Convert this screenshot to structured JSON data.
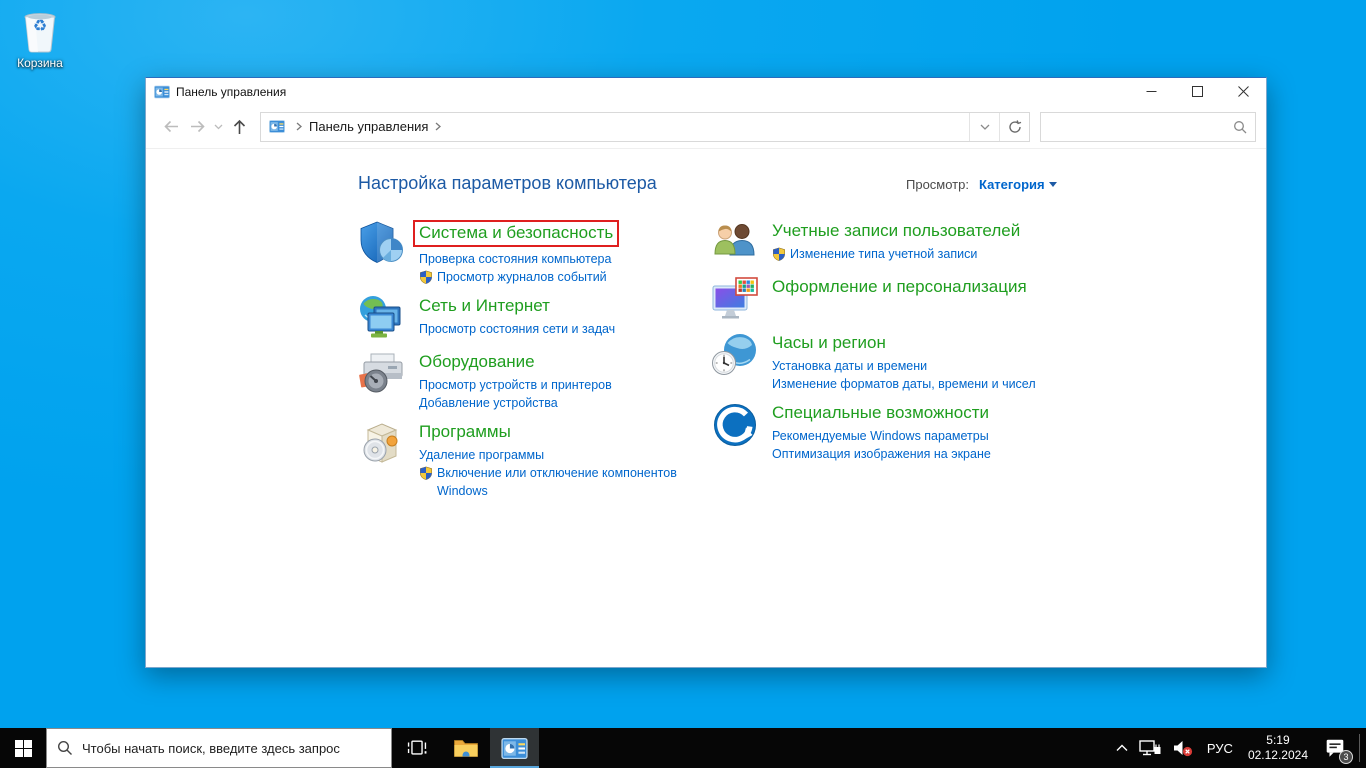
{
  "desktop": {
    "recycle_bin_label": "Корзина"
  },
  "window": {
    "title": "Панель управления",
    "breadcrumb_root": "Панель управления",
    "search_value": ""
  },
  "content": {
    "heading": "Настройка параметров компьютера",
    "view_by_label": "Просмотр:",
    "view_by_value": "Категория",
    "left": [
      {
        "title": "Система и безопасность",
        "highlighted": true,
        "links": [
          {
            "text": "Проверка состояния компьютера",
            "uac": false
          },
          {
            "text": "Просмотр журналов событий",
            "uac": true
          }
        ]
      },
      {
        "title": "Сеть и Интернет",
        "links": [
          {
            "text": "Просмотр состояния сети и задач",
            "uac": false
          }
        ]
      },
      {
        "title": "Оборудование",
        "links": [
          {
            "text": "Просмотр устройств и принтеров",
            "uac": false
          },
          {
            "text": "Добавление устройства",
            "uac": false
          }
        ]
      },
      {
        "title": "Программы",
        "links": [
          {
            "text": "Удаление программы",
            "uac": false
          },
          {
            "text": "Включение или отключение компонентов Windows",
            "uac": true
          }
        ]
      }
    ],
    "right": [
      {
        "title": "Учетные записи пользователей",
        "links": [
          {
            "text": "Изменение типа учетной записи",
            "uac": true
          }
        ]
      },
      {
        "title": "Оформление и персонализация",
        "links": []
      },
      {
        "title": "Часы и регион",
        "links": [
          {
            "text": "Установка даты и времени",
            "uac": false
          },
          {
            "text": "Изменение форматов даты, времени и чисел",
            "uac": false
          }
        ]
      },
      {
        "title": "Специальные возможности",
        "links": [
          {
            "text": "Рекомендуемые Windows параметры",
            "uac": false
          },
          {
            "text": "Оптимизация изображения на экране",
            "uac": false
          }
        ]
      }
    ]
  },
  "taskbar": {
    "search_placeholder": "Чтобы начать поиск, введите здесь запрос",
    "tray": {
      "language": "РУС",
      "time": "5:19",
      "date": "02.12.2024",
      "notification_badge": "3"
    }
  },
  "colors": {
    "category_title_green": "#1f9e1f",
    "link_blue": "#0066cc",
    "heading_blue": "#1d5aa5",
    "highlight_red": "#df1f1f",
    "desktop_blue": "#00a2ee",
    "taskbar_black": "#060606",
    "active_app_underline": "#58a6dc"
  }
}
